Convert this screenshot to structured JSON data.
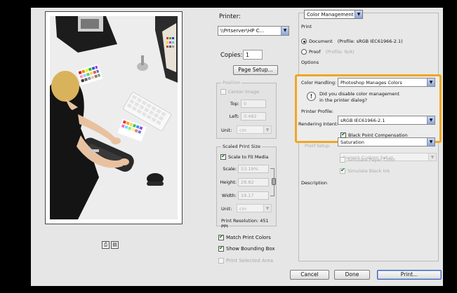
{
  "printer": {
    "label": "Printer:",
    "value": "\\\\Prtserver\\HP C..."
  },
  "copies": {
    "label": "Copies:",
    "value": "1"
  },
  "page_setup_label": "Page Setup...",
  "position": {
    "title": "Position",
    "center_image": "Center Image",
    "top_label": "Top:",
    "top_value": "0",
    "left_label": "Left:",
    "left_value": "0.482",
    "unit_label": "Unit:",
    "unit_value": "cm"
  },
  "scaled_size": {
    "title": "Scaled Print Size",
    "scale_to_fit": "Scale to Fit Media",
    "scale_label": "Scale:",
    "scale_value": "53.19%",
    "height_label": "Height:",
    "height_value": "28.82",
    "width_label": "Width:",
    "width_value": "19.17",
    "unit_label": "Unit:",
    "unit_value": "cm",
    "resolution": "Print Resolution: 451 PPI"
  },
  "options": {
    "match_print_colors": "Match Print Colors",
    "show_bounding_box": "Show Bounding Box",
    "print_selected_area": "Print Selected Area"
  },
  "right": {
    "section_select": "Color Management",
    "print_label": "Print",
    "document_label": "Document",
    "document_profile": "(Profile: sRGB IEC61966-2.1)",
    "proof_label": "Proof",
    "proof_profile": "(Profile: N/A)",
    "options_label": "Options",
    "color_handling_label": "Color Handling:",
    "color_handling_value": "Photoshop Manages Colors",
    "warning_line1": "Did you disable color management",
    "warning_line2": "in the printer dialog?",
    "printer_profile_label": "Printer Profile:",
    "printer_profile_value": "sRGB IEC61966-2.1",
    "rendering_intent_label": "Rendering Intent:",
    "rendering_intent_value": "Saturation",
    "bpc_label": "Black Point Compensation",
    "proof_setup_label": "Proof Setup:",
    "proof_setup_value": "Current Custom Setup",
    "simulate_paper": "Simulate Paper Color",
    "simulate_ink": "Simulate Black Ink",
    "description_label": "Description"
  },
  "buttons": {
    "cancel": "Cancel",
    "done": "Done",
    "print": "Print..."
  },
  "colors": {
    "highlight": "#f0a623",
    "check": "#157a1a",
    "dialog_bg": "#e6e6e6"
  }
}
